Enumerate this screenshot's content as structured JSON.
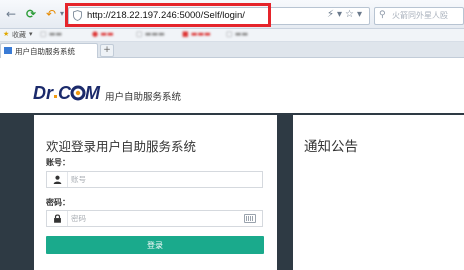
{
  "browser": {
    "url": "http://218.22.197.246:5000/Self/login/",
    "search_placeholder": "火箭同外星人殴",
    "bookmarks": {
      "favorites_label": "收藏"
    },
    "tab": {
      "title": "用户自助服务系统",
      "new_tab_symbol": "+"
    }
  },
  "header": {
    "logo_text": "Dr.COM",
    "site_title": "用户自助服务系统"
  },
  "login": {
    "title": "欢迎登录用户自助服务系统",
    "account_label": "账号：",
    "account_placeholder": "账号",
    "password_label": "密码：",
    "password_placeholder": "密码",
    "submit_label": "登录"
  },
  "notice": {
    "title": "通知公告"
  },
  "colors": {
    "accent": "#1aaa8c",
    "page_bg": "#2e3a44",
    "highlight": "#e5242b",
    "logo_orange": "#f39c12"
  }
}
